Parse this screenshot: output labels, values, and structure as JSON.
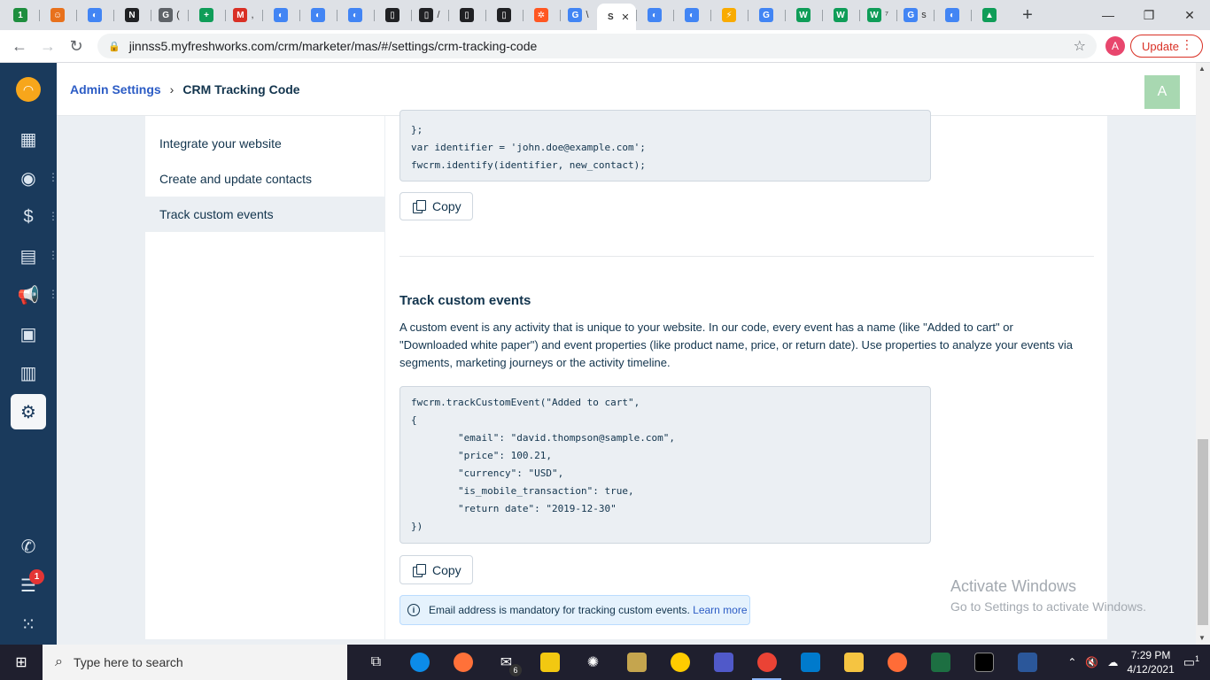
{
  "browser": {
    "tabs": [
      {
        "icon": "1",
        "color": "#1e8e3e",
        "label": ""
      },
      {
        "icon": "☺",
        "color": "#e8711c",
        "label": ""
      },
      {
        "icon": "◐",
        "color": "#4285f4",
        "label": ""
      },
      {
        "icon": "N",
        "color": "#202124",
        "label": ""
      },
      {
        "icon": "G",
        "color": "#5f6368",
        "label": "("
      },
      {
        "icon": "+",
        "color": "#0f9d58",
        "label": ""
      },
      {
        "icon": "M",
        "color": "#d93025",
        "label": ","
      },
      {
        "icon": "◐",
        "color": "#4285f4",
        "label": ""
      },
      {
        "icon": "◐",
        "color": "#4285f4",
        "label": ""
      },
      {
        "icon": "◐",
        "color": "#4285f4",
        "label": ""
      },
      {
        "icon": "▯",
        "color": "#202124",
        "label": ""
      },
      {
        "icon": "▯",
        "color": "#202124",
        "label": "/"
      },
      {
        "icon": "▯",
        "color": "#202124",
        "label": ""
      },
      {
        "icon": "▯",
        "color": "#202124",
        "label": ""
      },
      {
        "icon": "✲",
        "color": "#ff5722",
        "label": ""
      },
      {
        "icon": "G",
        "color": "#4285f4",
        "label": "\\"
      },
      {
        "icon": "S",
        "color": "#ffffff",
        "label": "✕",
        "active": true
      },
      {
        "icon": "◐",
        "color": "#4285f4",
        "label": ""
      },
      {
        "icon": "◐",
        "color": "#4285f4",
        "label": ""
      },
      {
        "icon": "⚡",
        "color": "#f9ab00",
        "label": ""
      },
      {
        "icon": "G",
        "color": "#4285f4",
        "label": ""
      },
      {
        "icon": "W",
        "color": "#0f9d58",
        "label": ""
      },
      {
        "icon": "W",
        "color": "#0f9d58",
        "label": ""
      },
      {
        "icon": "W",
        "color": "#0f9d58",
        "label": "⁷"
      },
      {
        "icon": "G",
        "color": "#4285f4",
        "label": "s"
      },
      {
        "icon": "◐",
        "color": "#4285f4",
        "label": ""
      },
      {
        "icon": "▲",
        "color": "#0f9d58",
        "label": ""
      }
    ],
    "new_tab": "+",
    "url": "jinnss5.myfreshworks.com/crm/marketer/mas/#/settings/crm-tracking-code",
    "profile_letter": "A",
    "update_label": "Update"
  },
  "header": {
    "breadcrumb_root": "Admin Settings",
    "breadcrumb_current": "CRM Tracking Code",
    "avatar_letter": "A"
  },
  "subnav": {
    "items": [
      {
        "label": "Integrate your website"
      },
      {
        "label": "Create and update contacts"
      },
      {
        "label": "Track custom events"
      }
    ]
  },
  "code_top": {
    "lines": [
      "};",
      "var identifier = 'john.doe@example.com';",
      "fwcrm.identify(identifier, new_contact);"
    ]
  },
  "copy_label": "Copy",
  "section": {
    "title": "Track custom events",
    "description": "A custom event is any activity that is unique to your website. In our code, every event has a name (like \"Added to cart\" or \"Downloaded white paper\") and event properties (like product name, price, or return date). Use properties to analyze your events via segments, marketing journeys or the activity timeline."
  },
  "code_bottom": {
    "lines": [
      "fwcrm.trackCustomEvent(\"Added to cart\",",
      "{",
      "        \"email\": \"david.thompson@sample.com\",",
      "        \"price\": 100.21,",
      "        \"currency\": \"USD\",",
      "        \"is_mobile_transaction\": true,",
      "        \"return date\": \"2019-12-30\"",
      "})"
    ]
  },
  "info": {
    "text": "Email address is mandatory for tracking custom events.",
    "link": "Learn more"
  },
  "watermark": {
    "line1": "Activate Windows",
    "line2": "Go to Settings to activate Windows."
  },
  "rail": {
    "notification_count": "1"
  },
  "taskbar": {
    "search_placeholder": "Type here to search",
    "mail_badge": "6",
    "time": "7:29 PM",
    "date": "4/12/2021",
    "notif_count": "1"
  }
}
